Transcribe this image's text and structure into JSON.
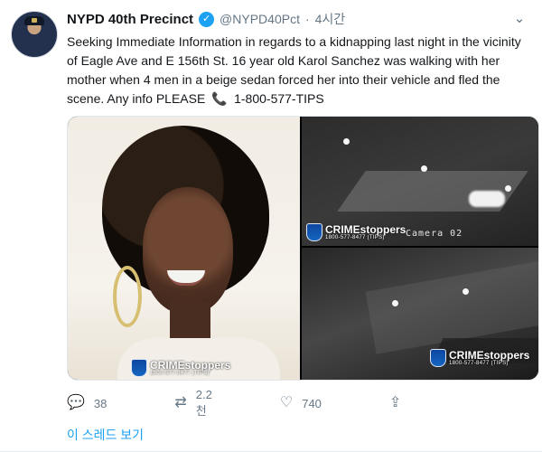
{
  "tweet": {
    "display_name": "NYPD 40th Precinct",
    "handle": "@NYPD40Pct",
    "separator": "·",
    "time": "4시간",
    "verified_icon": "check-icon",
    "text_part1": "Seeking Immediate Information in regards to a kidnapping last night in the vicinity of Eagle Ave and E 156th St. 16 year old Karol Sanchez was walking with her mother when 4 men in a beige sedan forced her into their vehicle and fled the scene. Any info PLEASE",
    "phone_emoji": "📞",
    "text_part2": "1-800-577-TIPS",
    "media": {
      "camera_label": "Camera 02",
      "crimestoppers": "CRIMEstoppers",
      "crimestoppers_phone": "1800-577-8477 (TIPS)"
    },
    "actions": {
      "reply_count": "38",
      "retweet_count": "2.2천",
      "like_count": "740"
    },
    "thread_label": "이 스레드 보기"
  },
  "colors": {
    "accent": "#1da1f2",
    "muted": "#657786",
    "text": "#14171a"
  }
}
